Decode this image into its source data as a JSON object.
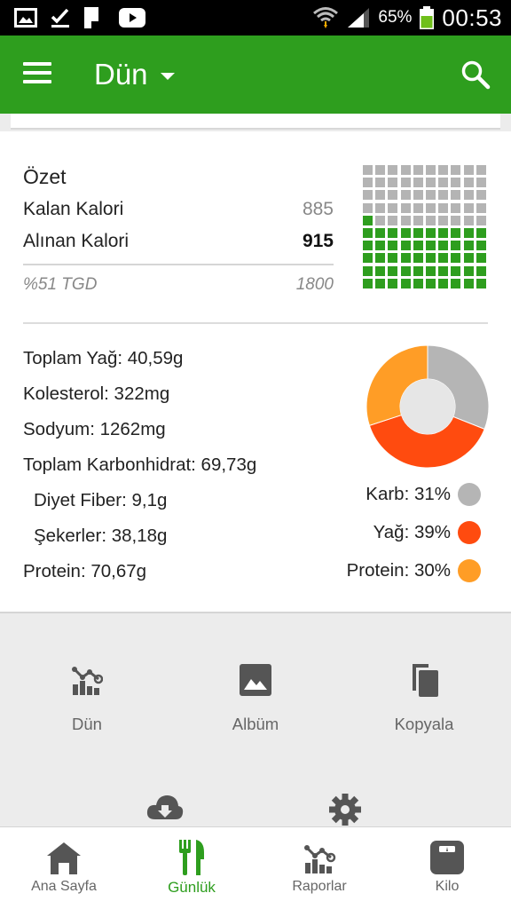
{
  "status_bar": {
    "battery_percent": "65%",
    "time": "00:53"
  },
  "app_bar": {
    "title": "Dün"
  },
  "summary": {
    "title": "Özet",
    "remaining_label": "Kalan Kalori",
    "remaining_value": "885",
    "consumed_label": "Alınan Kalori",
    "consumed_value": "915",
    "tdee_label": "%51 TGD",
    "tdee_value": "1800",
    "waffle_filled_fraction": 0.51
  },
  "nutrients": {
    "fat": "Toplam Yağ: 40,59g",
    "cholesterol": "Kolesterol: 322mg",
    "sodium": "Sodyum: 1262mg",
    "carbs": "Toplam Karbonhidrat: 69,73g",
    "fiber": "Diyet Fiber: 9,1g",
    "sugars": "Şekerler: 38,18g",
    "protein": "Protein: 70,67g"
  },
  "macros": [
    {
      "label": "Karb: 31%",
      "percent": 31,
      "color": "#b5b5b5"
    },
    {
      "label": "Yağ: 39%",
      "percent": 39,
      "color": "#ff4b0f"
    },
    {
      "label": "Protein: 30%",
      "percent": 30,
      "color": "#ff9d26"
    }
  ],
  "actions": {
    "yesterday": "Dün",
    "album": "Albüm",
    "copy": "Kopyala"
  },
  "bottom_nav": {
    "home": "Ana Sayfa",
    "diary": "Günlük",
    "reports": "Raporlar",
    "weight": "Kilo"
  },
  "colors": {
    "primary": "#2e9e1e",
    "waffle_empty": "#b4b4b4"
  }
}
